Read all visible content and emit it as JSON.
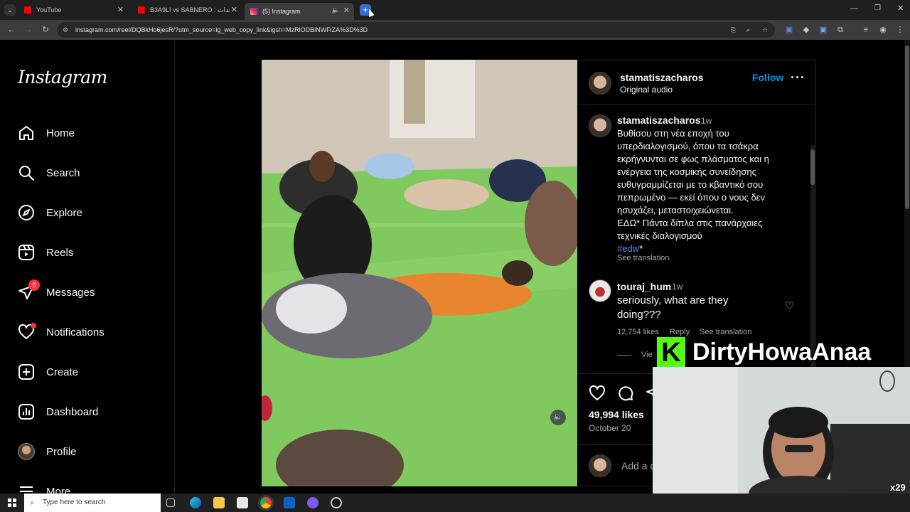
{
  "browser": {
    "tabs": [
      {
        "title": "YouTube",
        "color": "#ff0000",
        "active": false
      },
      {
        "title": "B3A9LI vs SABNERO : ج للأحداث",
        "color": "#ff0000",
        "active": false
      },
      {
        "title": "(5) Instagram",
        "color": "#e1306c",
        "active": true
      }
    ],
    "url": "instagram.com/reel/DQBkHo6jesR/?utm_source=ig_web_copy_link&igsh=MzRlODBiNWFiZA%3D%3D"
  },
  "sidebar": {
    "logo": "Instagram",
    "items": [
      {
        "label": "Home",
        "icon": "home-icon"
      },
      {
        "label": "Search",
        "icon": "search-icon"
      },
      {
        "label": "Explore",
        "icon": "explore-icon"
      },
      {
        "label": "Reels",
        "icon": "reels-icon"
      },
      {
        "label": "Messages",
        "icon": "messages-icon",
        "badge": "5"
      },
      {
        "label": "Notifications",
        "icon": "heart-icon"
      },
      {
        "label": "Create",
        "icon": "create-icon"
      },
      {
        "label": "Dashboard",
        "icon": "dashboard-icon"
      },
      {
        "label": "Profile",
        "icon": "avatar"
      },
      {
        "label": "More",
        "icon": "menu-icon"
      }
    ]
  },
  "post": {
    "author": "stamatiszacharos",
    "audio": "Original audio",
    "follow": "Follow",
    "caption_author": "stamatiszacharos",
    "caption_time": "1w",
    "caption_lines": [
      "Βυθίσου στη νέα εποχή του",
      "υπερδιαλογισμού, όπου τα τσάκρα",
      "εκρήγνυνται σε φως πλάσματος και η",
      "ενέργεια της κοσμικής συνείδησης",
      "ευθυγραμμίζεται με το κβαντικό σου",
      "πεπρωμένο — εκεί όπου ο νους δεν",
      "ησυχάζει, μεταστοιχειώνεται.",
      "ΕΔΩ* Πάντα δίπλα στις πανάρχαιες",
      "τεχνικές διαλογισμού"
    ],
    "hashtag": "#edw",
    "hashtag_suffix": "*",
    "see_translation": "See translation",
    "comment": {
      "user": "touraj_hum",
      "time": "1w",
      "lines": [
        "seriously, what are they",
        "doing???"
      ],
      "likes": "12,754 likes",
      "reply": "Reply",
      "translate": "See translation",
      "view_replies": "Vie"
    },
    "likes": "49,994 likes",
    "date": "October 20",
    "add_comment": "Add a c"
  },
  "overlay": {
    "banner_text": "DirtyHowaAnaa",
    "banner_logo": "K",
    "multiplier": "x29"
  },
  "taskbar": {
    "search_placeholder": "Type here to search"
  },
  "colors": {
    "follow": "#0095f6",
    "hashtag": "#e0f1ff",
    "badge": "#ff3040",
    "kick_green": "#53fc18"
  }
}
